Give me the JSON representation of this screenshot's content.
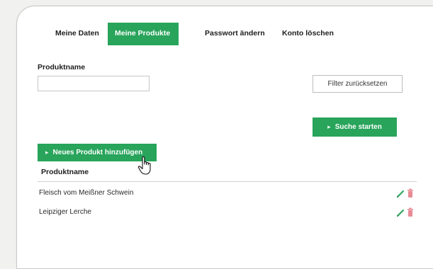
{
  "tabs": [
    {
      "label": "Meine Daten",
      "active": false
    },
    {
      "label": "Meine Produkte",
      "active": true
    },
    {
      "label": "Passwort ändern",
      "active": false
    },
    {
      "label": "Konto löschen",
      "active": false
    }
  ],
  "filter": {
    "label": "Produktname",
    "input_value": "",
    "reset_label": "Filter zurücksetzen",
    "search_label": "Suche starten"
  },
  "products": {
    "add_label": "Neues Produkt hinzufügen",
    "column_header": "Produktname",
    "rows": [
      {
        "name": "Fleisch vom Meißner Schwein"
      },
      {
        "name": "Leipziger Lerche"
      }
    ]
  },
  "icons": {
    "edit": "pencil-icon",
    "delete": "trash-icon",
    "chevron": "chevron-right-icon",
    "cursor": "hand-pointer-icon"
  },
  "colors": {
    "accent": "#28a45b",
    "delete": "#e88a94",
    "edit": "#28a45b"
  }
}
